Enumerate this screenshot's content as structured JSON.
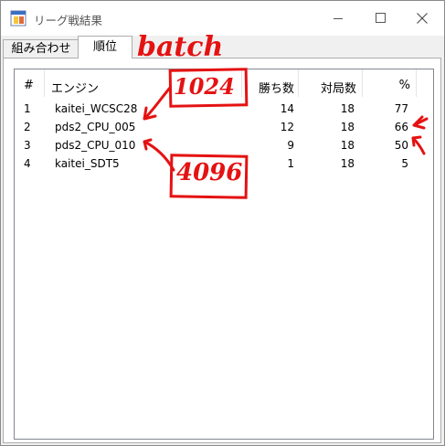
{
  "window": {
    "title": "リーグ戦結果",
    "tabs": [
      "組み合わせ",
      "順位"
    ],
    "active_tab": "順位"
  },
  "table": {
    "columns": [
      "#",
      "エンジン",
      "勝ち数",
      "対局数",
      "%"
    ],
    "rows": [
      [
        "1",
        "kaitei_WCSC28",
        "14",
        "18",
        "77"
      ],
      [
        "2",
        "pds2_CPU_005",
        "12",
        "18",
        "66"
      ],
      [
        "3",
        "pds2_CPU_010",
        "9",
        "18",
        "50"
      ],
      [
        "4",
        "kaitei_SDT5",
        "1",
        "18",
        "5"
      ]
    ]
  },
  "annotations": {
    "batch": "batch",
    "value_1": "1024",
    "value_2": "4096",
    "color": "#e51212"
  },
  "icons": [
    "app-icon",
    "minimize-icon",
    "maximize-icon",
    "close-icon"
  ]
}
